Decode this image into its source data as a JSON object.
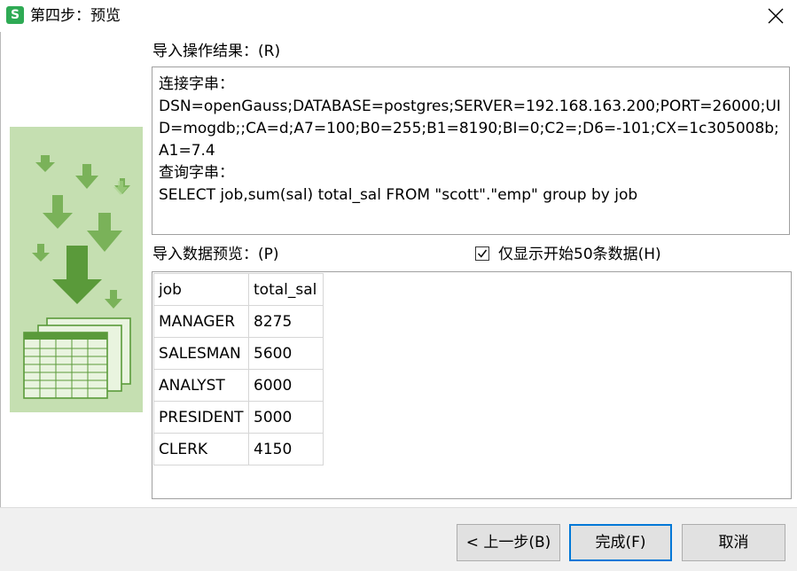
{
  "window": {
    "title": "第四步：预览",
    "app_icon_letter": "S"
  },
  "import_result": {
    "label": "导入操作结果：(R)",
    "lines": [
      "连接字串：",
      "DSN=openGauss;DATABASE=postgres;SERVER=192.168.163.200;PORT=26000;UID=mogdb;;CA=d;A7=100;B0=255;B1=8190;BI=0;C2=;D6=-101;CX=1c305008b;A1=7.4",
      "查询字串：",
      "SELECT job,sum(sal) total_sal FROM \"scott\".\"emp\"  group by job"
    ]
  },
  "preview": {
    "label": "导入数据预览：(P)",
    "checkbox_label": "仅显示开始50条数据(H)",
    "checkbox_checked": true,
    "columns": [
      "job",
      "total_sal"
    ],
    "rows": [
      [
        "MANAGER",
        "8275"
      ],
      [
        "SALESMAN",
        "5600"
      ],
      [
        "ANALYST",
        "6000"
      ],
      [
        "PRESIDENT",
        "5000"
      ],
      [
        "CLERK",
        "4150"
      ]
    ]
  },
  "buttons": {
    "back": "< 上一步(B)",
    "finish": "完成(F)",
    "cancel": "取消"
  },
  "colors": {
    "illustration_bg": "#c5dfb1",
    "arrow_dark": "#5a9a3a",
    "arrow_light": "#9ccf83",
    "accent": "#0078d7"
  },
  "icons": [
    "app-icon",
    "close-icon",
    "checkmark-icon",
    "import-illustration"
  ]
}
